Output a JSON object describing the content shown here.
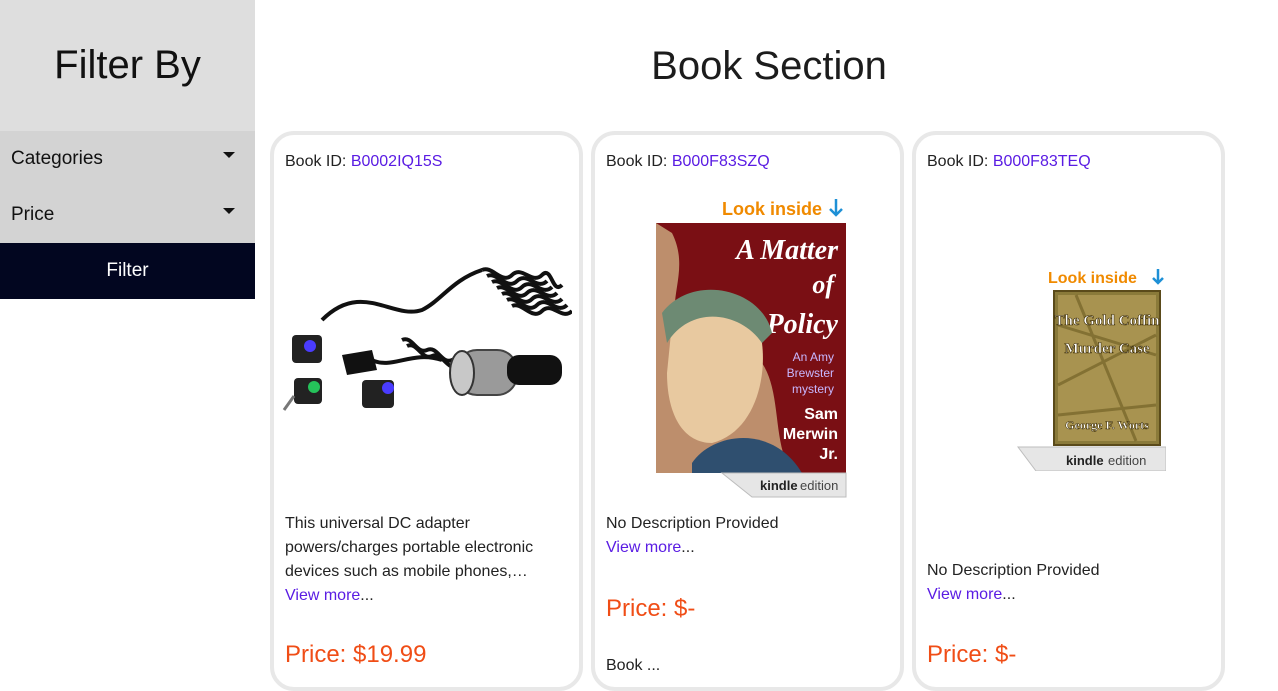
{
  "sidebar": {
    "title": "Filter By",
    "dropdowns": [
      {
        "label": "Categories"
      },
      {
        "label": "Price"
      }
    ],
    "filter_button": "Filter"
  },
  "main": {
    "title": "Book Section"
  },
  "cards": [
    {
      "id_prefix": "Book ID: ",
      "id": "B0002IQ15S",
      "description": "This universal DC adapter powers/charges portable electronic devices such as mobile phones,…",
      "view_more": "View more",
      "ellipsis": "...",
      "price": "Price: $19.99"
    },
    {
      "id_prefix": "Book ID: ",
      "id": "B000F83SZQ",
      "cover": {
        "look_inside": "Look inside",
        "title_1": "A Matter",
        "title_2": "of",
        "title_3": "Policy",
        "subtitle_1": "An Amy",
        "subtitle_2": "Brewster",
        "subtitle_3": "mystery",
        "author_1": "Sam",
        "author_2": "Merwin",
        "author_3": "Jr.",
        "edition_bold": "kindle",
        "edition": "edition"
      },
      "description": "No Description Provided",
      "view_more": "View more",
      "ellipsis": "...",
      "price": "Price: $-",
      "extra": "Book ... "
    },
    {
      "id_prefix": "Book ID: ",
      "id": "B000F83TEQ",
      "cover": {
        "look_inside": "Look inside",
        "title_1": "The Gold Coffin",
        "title_2": "Murder Case",
        "author": "George F. Worts",
        "edition_bold": "kindle",
        "edition": "edition"
      },
      "description": "No Description Provided",
      "view_more": "View more",
      "ellipsis": "...",
      "price": "Price: $-"
    }
  ]
}
